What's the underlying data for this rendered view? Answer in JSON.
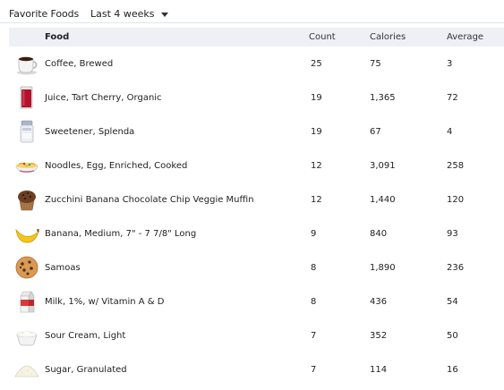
{
  "header": {
    "title": "Favorite Foods",
    "range_label": "Last 4 weeks"
  },
  "table": {
    "columns": {
      "food": "Food",
      "count": "Count",
      "calories": "Calories",
      "average": "Average"
    },
    "rows": [
      {
        "icon": "coffee-cup-icon",
        "food": "Coffee, Brewed",
        "count": "25",
        "calories": "75",
        "average": "3"
      },
      {
        "icon": "juice-glass-icon",
        "food": "Juice, Tart Cherry, Organic",
        "count": "19",
        "calories": "1,365",
        "average": "72"
      },
      {
        "icon": "sweetener-shaker-icon",
        "food": "Sweetener, Splenda",
        "count": "19",
        "calories": "67",
        "average": "4"
      },
      {
        "icon": "noodles-bowl-icon",
        "food": "Noodles, Egg, Enriched, Cooked",
        "count": "12",
        "calories": "3,091",
        "average": "258"
      },
      {
        "icon": "muffin-icon",
        "food": "Zucchini Banana Chocolate Chip Veggie Muffin",
        "count": "12",
        "calories": "1,440",
        "average": "120"
      },
      {
        "icon": "banana-icon",
        "food": "Banana, Medium, 7\" - 7 7/8\" Long",
        "count": "9",
        "calories": "840",
        "average": "93"
      },
      {
        "icon": "cookie-icon",
        "food": "Samoas",
        "count": "8",
        "calories": "1,890",
        "average": "236"
      },
      {
        "icon": "milk-carton-icon",
        "food": "Milk, 1%, w/ Vitamin A & D",
        "count": "8",
        "calories": "436",
        "average": "54"
      },
      {
        "icon": "sour-cream-bowl-icon",
        "food": "Sour Cream, Light",
        "count": "7",
        "calories": "352",
        "average": "50"
      },
      {
        "icon": "sugar-pile-icon",
        "food": "Sugar, Granulated",
        "count": "7",
        "calories": "114",
        "average": "16"
      }
    ]
  }
}
